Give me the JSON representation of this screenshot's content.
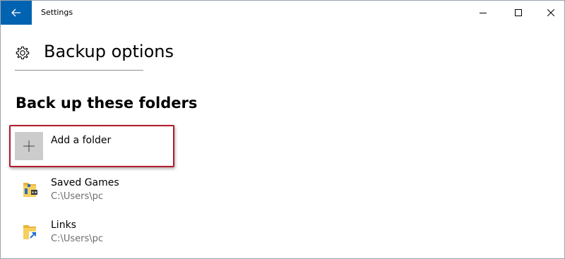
{
  "window": {
    "title": "Settings"
  },
  "header": {
    "title": "Backup options"
  },
  "section": {
    "title": "Back up these folders"
  },
  "add_folder": {
    "label": "Add a folder"
  },
  "folders": [
    {
      "name": "Saved Games",
      "path": "C:\\Users\\pc",
      "icon": "saved-games-folder-icon"
    },
    {
      "name": "Links",
      "path": "C:\\Users\\pc",
      "icon": "links-folder-icon"
    }
  ],
  "colors": {
    "accent": "#0063b1",
    "highlight_border": "#b01c2c",
    "add_tile": "#cccccc",
    "secondary_text": "#6d6d6d"
  }
}
